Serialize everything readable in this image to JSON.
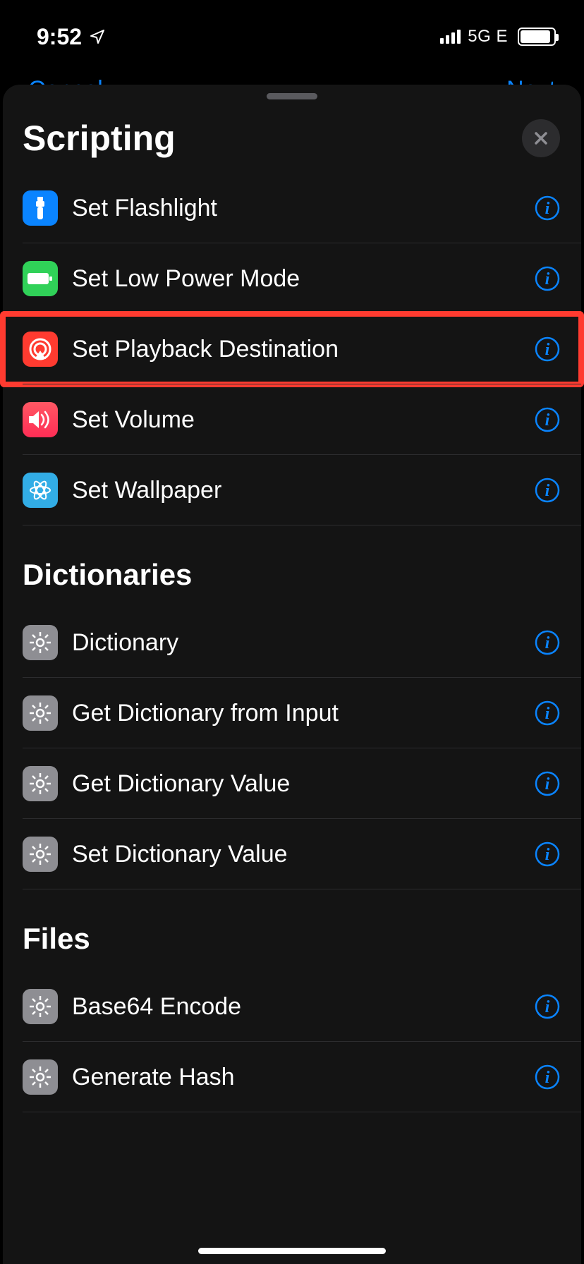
{
  "status": {
    "time": "9:52",
    "network_label": "5G E"
  },
  "behind": {
    "left": "Cancel",
    "right": "Next"
  },
  "sheet": {
    "title": "Scripting",
    "sections": [
      {
        "title": null,
        "items": [
          {
            "label": "Set Flashlight"
          },
          {
            "label": "Set Low Power Mode"
          },
          {
            "label": "Set Playback Destination"
          },
          {
            "label": "Set Volume"
          },
          {
            "label": "Set Wallpaper"
          }
        ]
      },
      {
        "title": "Dictionaries",
        "items": [
          {
            "label": "Dictionary"
          },
          {
            "label": "Get Dictionary from Input"
          },
          {
            "label": "Get Dictionary Value"
          },
          {
            "label": "Set Dictionary Value"
          }
        ]
      },
      {
        "title": "Files",
        "items": [
          {
            "label": "Base64 Encode"
          },
          {
            "label": "Generate Hash"
          }
        ]
      }
    ]
  }
}
